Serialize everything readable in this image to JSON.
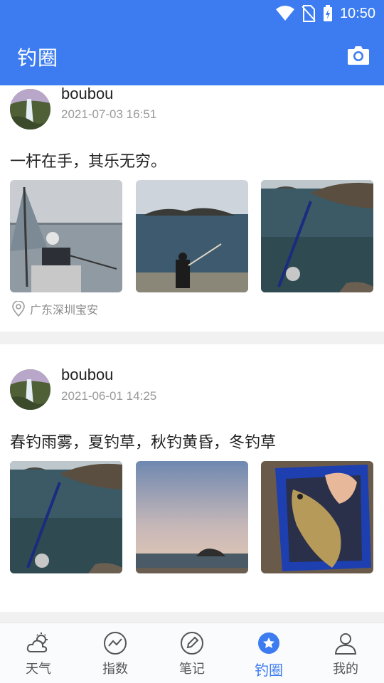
{
  "status_bar": {
    "time": "10:50"
  },
  "header": {
    "title": "钓圈"
  },
  "posts": [
    {
      "username": "boubou",
      "time": "2021-07-03 16:51",
      "text": "一杆在手，其乐无穷。",
      "location": "广东深圳宝安",
      "photos": [
        "umbrella-fisherman",
        "sunset-island-fisherman",
        "rocky-shore-rod"
      ]
    },
    {
      "username": "boubou",
      "time": "2021-06-01 14:25",
      "text": "春钓雨雾，夏钓草，秋钓黄昏，冬钓草",
      "photos": [
        "rocky-shore-rod",
        "dusk-island-sea",
        "fish-in-bag"
      ]
    }
  ],
  "bottom_nav": [
    {
      "label": "天气",
      "icon": "weather-icon",
      "active": false
    },
    {
      "label": "指数",
      "icon": "index-chart-icon",
      "active": false
    },
    {
      "label": "笔记",
      "icon": "note-pencil-icon",
      "active": false
    },
    {
      "label": "钓圈",
      "icon": "circle-star-icon",
      "active": true
    },
    {
      "label": "我的",
      "icon": "profile-icon",
      "active": false
    }
  ],
  "colors": {
    "primary": "#3d7cf0",
    "divider": "#f1f1f1",
    "muted": "#999999"
  }
}
